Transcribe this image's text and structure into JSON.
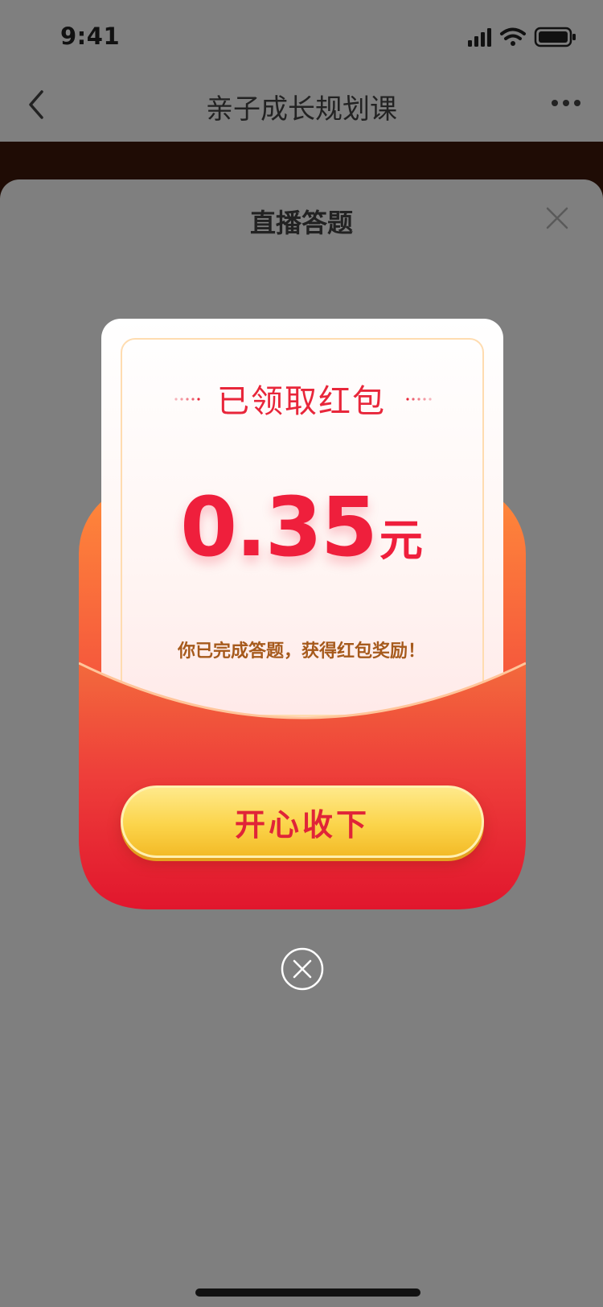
{
  "status_bar": {
    "time": "9:41",
    "icons": [
      "cellular-signal-icon",
      "wifi-icon",
      "battery-icon"
    ]
  },
  "nav": {
    "title": "亲子成长规划课",
    "back_icon": "chevron-left-icon",
    "more_icon": "more-horizontal-icon"
  },
  "sheet": {
    "title": "直播答题",
    "close_icon": "close-icon"
  },
  "red_envelope": {
    "title": "已领取红包",
    "amount": "0.35",
    "unit": "元",
    "message": "你已完成答题，获得红包奖励！",
    "button_label": "开心收下",
    "dismiss_icon": "circle-close-icon"
  },
  "colors": {
    "accent_red": "#e8263a",
    "envelope_orange": "#ff8a3a",
    "envelope_red": "#e1162d",
    "button_gold": "#fbd44a",
    "overlay_gray": "#7f7f7f",
    "message_brown": "#a65a1c"
  }
}
